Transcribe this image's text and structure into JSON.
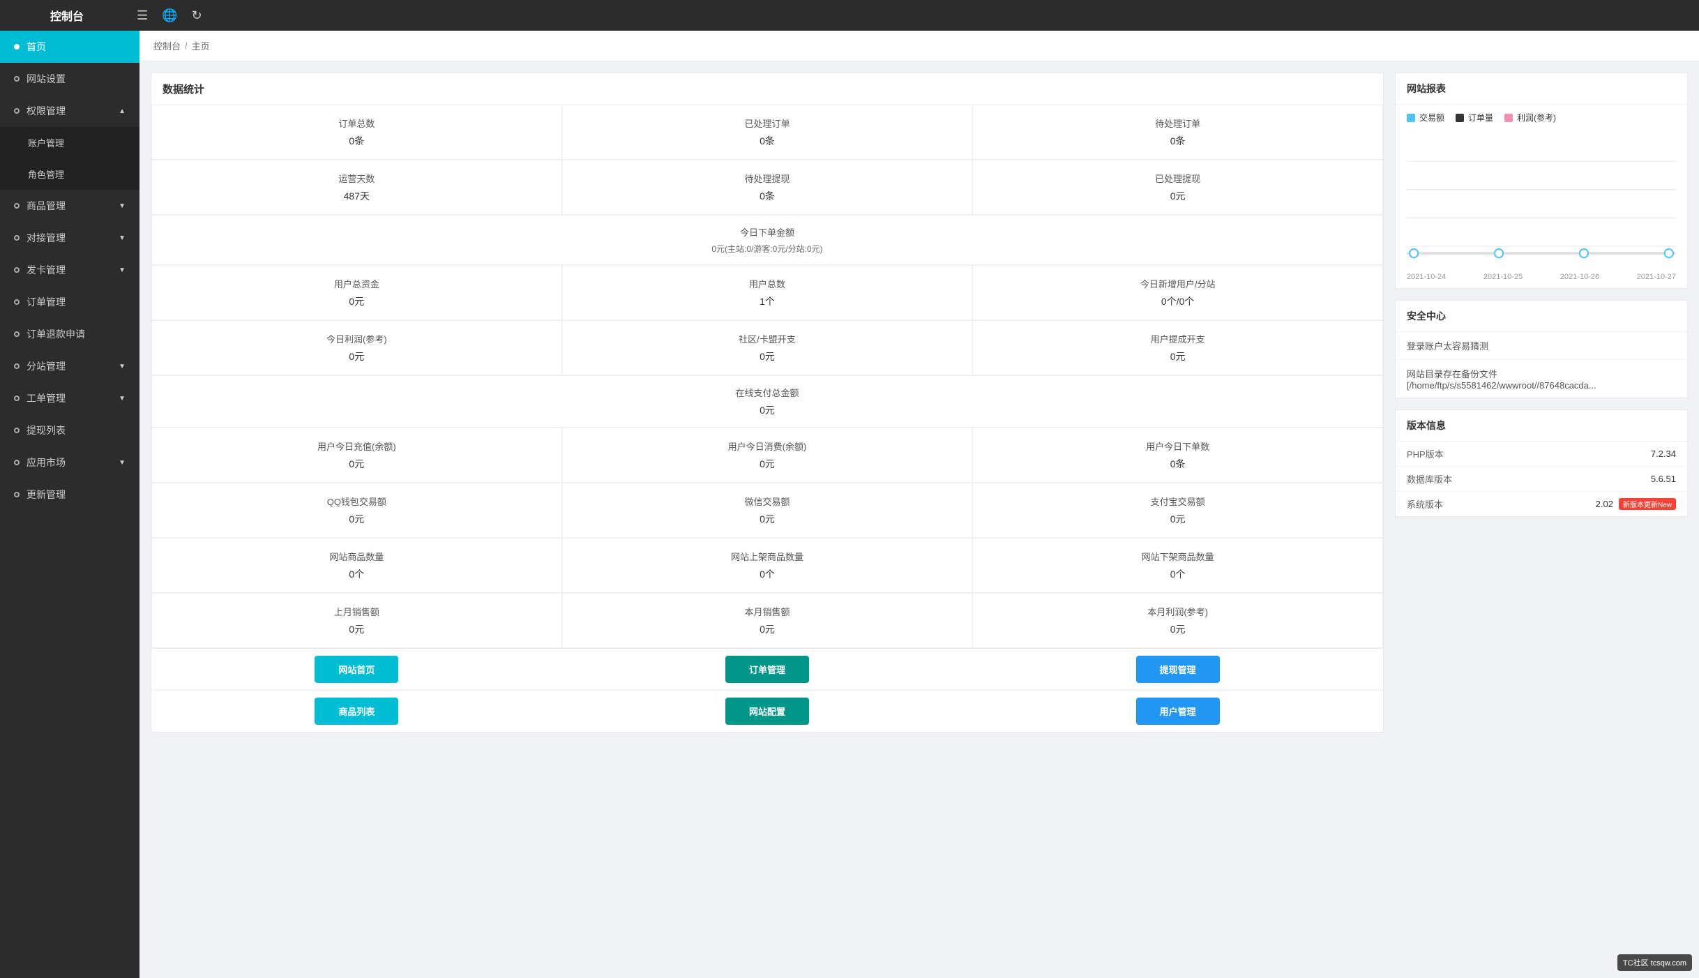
{
  "topbar": {
    "title": "控制台",
    "icons": [
      "menu-icon",
      "globe-icon",
      "refresh-icon"
    ]
  },
  "breadcrumb": {
    "items": [
      "控制台",
      "主页"
    ]
  },
  "sidebar": {
    "items": [
      {
        "id": "home",
        "label": "首页",
        "active": true,
        "hasArrow": false,
        "hasSub": false
      },
      {
        "id": "site-settings",
        "label": "网站设置",
        "active": false,
        "hasArrow": false,
        "hasSub": false
      },
      {
        "id": "permission",
        "label": "权限管理",
        "active": false,
        "hasArrow": true,
        "hasSub": true,
        "sub": [
          {
            "id": "account-mgmt",
            "label": "账户管理"
          },
          {
            "id": "role-mgmt",
            "label": "角色管理"
          }
        ]
      },
      {
        "id": "product",
        "label": "商品管理",
        "active": false,
        "hasArrow": true,
        "hasSub": false
      },
      {
        "id": "connect",
        "label": "对接管理",
        "active": false,
        "hasArrow": true,
        "hasSub": false
      },
      {
        "id": "card-issue",
        "label": "发卡管理",
        "active": false,
        "hasArrow": true,
        "hasSub": false
      },
      {
        "id": "order",
        "label": "订单管理",
        "active": false,
        "hasArrow": false,
        "hasSub": false
      },
      {
        "id": "refund",
        "label": "订单退款申请",
        "active": false,
        "hasArrow": false,
        "hasSub": false
      },
      {
        "id": "substation",
        "label": "分站管理",
        "active": false,
        "hasArrow": true,
        "hasSub": false
      },
      {
        "id": "workorder",
        "label": "工单管理",
        "active": false,
        "hasArrow": true,
        "hasSub": false
      },
      {
        "id": "withdraw",
        "label": "提现列表",
        "active": false,
        "hasArrow": false,
        "hasSub": false
      },
      {
        "id": "appmarket",
        "label": "应用市场",
        "active": false,
        "hasArrow": true,
        "hasSub": false
      },
      {
        "id": "update",
        "label": "更新管理",
        "active": false,
        "hasArrow": false,
        "hasSub": false
      }
    ]
  },
  "stats": {
    "title": "数据统计",
    "cells": [
      {
        "label": "订单总数",
        "value": "0条"
      },
      {
        "label": "已处理订单",
        "value": "0条"
      },
      {
        "label": "待处理订单",
        "value": "0条"
      },
      {
        "label": "运营天数",
        "value": "487天"
      },
      {
        "label": "待处理提现",
        "value": "0条"
      },
      {
        "label": "已处理提现",
        "value": "0元"
      }
    ],
    "full_cell": {
      "label": "今日下单金额",
      "value": "0元(主站:0/游客:0元/分站:0元)"
    },
    "cells2": [
      {
        "label": "用户总资金",
        "value": "0元"
      },
      {
        "label": "用户总数",
        "value": "1个"
      },
      {
        "label": "今日新增用户/分站",
        "value": "0个/0个"
      },
      {
        "label": "今日利润(参考)",
        "value": "0元"
      },
      {
        "label": "社区/卡盟开支",
        "value": "0元"
      },
      {
        "label": "用户提成开支",
        "value": "0元"
      }
    ],
    "full_cell2": {
      "label": "在线支付总金额",
      "value": "0元"
    },
    "cells3": [
      {
        "label": "用户今日充值(余额)",
        "value": "0元"
      },
      {
        "label": "用户今日消费(余额)",
        "value": "0元"
      },
      {
        "label": "用户今日下单数",
        "value": "0条"
      },
      {
        "label": "QQ钱包交易额",
        "value": "0元"
      },
      {
        "label": "微信交易额",
        "value": "0元"
      },
      {
        "label": "支付宝交易额",
        "value": "0元"
      },
      {
        "label": "网站商品数量",
        "value": "0个"
      },
      {
        "label": "网站上架商品数量",
        "value": "0个"
      },
      {
        "label": "网站下架商品数量",
        "value": "0个"
      },
      {
        "label": "上月销售额",
        "value": "0元"
      },
      {
        "label": "本月销售额",
        "value": "0元"
      },
      {
        "label": "本月利润(参考)",
        "value": "0元"
      }
    ],
    "buttons_row1": [
      {
        "label": "网站首页",
        "class": "btn-cyan"
      },
      {
        "label": "订单管理",
        "class": "btn-teal"
      },
      {
        "label": "提现管理",
        "class": "btn-blue"
      }
    ],
    "buttons_row2": [
      {
        "label": "商品列表",
        "class": "btn-cyan"
      },
      {
        "label": "网站配置",
        "class": "btn-teal"
      },
      {
        "label": "用户管理",
        "class": "btn-blue"
      }
    ]
  },
  "chart": {
    "title": "网站报表",
    "legend": [
      {
        "label": "交易额",
        "color": "#4fc3f7"
      },
      {
        "label": "订单量",
        "color": "#333"
      },
      {
        "label": "利润(参考)",
        "color": "#f48fb1"
      }
    ],
    "dates": [
      "2021-10-24",
      "2021-10-25",
      "2021-10-26",
      "2021-10-27"
    ],
    "slider_positions": [
      0,
      33,
      66,
      100
    ]
  },
  "security": {
    "title": "安全中心",
    "items": [
      "登录账户太容易猜测",
      "网站目录存在备份文件 [/home/ftp/s/s5581462/wwwroot//87648cacda..."
    ]
  },
  "version": {
    "title": "版本信息",
    "rows": [
      {
        "label": "PHP版本",
        "value": "7.2.34",
        "badge": ""
      },
      {
        "label": "数据库版本",
        "value": "5.6.51",
        "badge": ""
      },
      {
        "label": "系统版本",
        "value": "2.02",
        "badge": "新版本更新New"
      }
    ]
  },
  "watermark": {
    "text": "TC社区 tcsqw.com"
  }
}
